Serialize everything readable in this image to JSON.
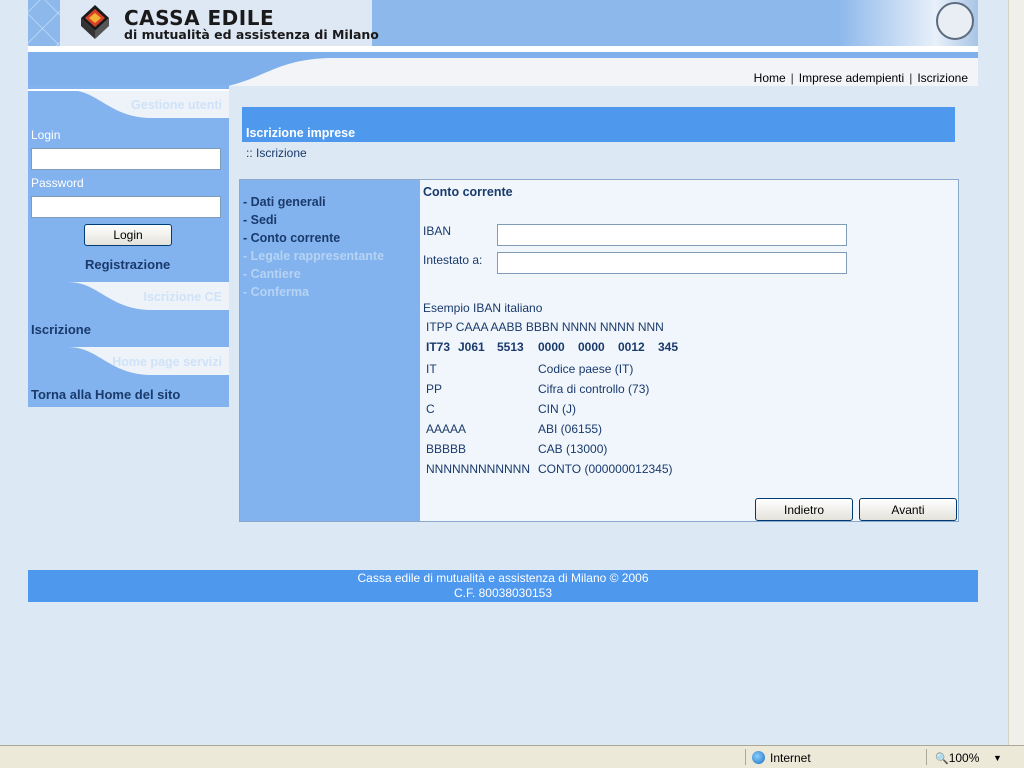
{
  "header": {
    "logo_title": "CASSA EDILE",
    "logo_subtitle": "di mutualità ed assistenza di Milano"
  },
  "topnav": {
    "items": [
      "Home",
      "Imprese adempienti",
      "Iscrizione"
    ]
  },
  "sidebar": {
    "section_users": "Gestione utenti",
    "login_label": "Login",
    "password_label": "Password",
    "login_value": "",
    "password_value": "",
    "login_button": "Login",
    "register_link": "Registrazione",
    "section_ce": "Iscrizione CE",
    "ce_link": "Iscrizione",
    "section_home": "Home page servizi",
    "home_link": "Torna alla Home del sito"
  },
  "main": {
    "title": "Iscrizione imprese",
    "breadcrumb": ":: Iscrizione",
    "steps": [
      {
        "label": "- Dati generali",
        "enabled": true
      },
      {
        "label": "- Sedi",
        "enabled": true
      },
      {
        "label": "- Conto corrente",
        "enabled": true
      },
      {
        "label": "- Legale rappresentante",
        "enabled": false
      },
      {
        "label": "- Cantiere",
        "enabled": false
      },
      {
        "label": "- Conferma",
        "enabled": false
      }
    ],
    "section_title": "Conto corrente",
    "iban_label": "IBAN",
    "iban_value": "",
    "holder_label": "Intestato a:",
    "holder_value": "",
    "example_title": "Esempio IBAN italiano",
    "example_format": "ITPP CAAA AABB BBBN NNNN NNNN NNN",
    "example_groups": [
      "IT73",
      "J061",
      "5513",
      "0000",
      "0000",
      "0012",
      "345"
    ],
    "legend": [
      {
        "code": "IT",
        "desc": "Codice paese (IT)"
      },
      {
        "code": "PP",
        "desc": "Cifra di controllo (73)"
      },
      {
        "code": "C",
        "desc": "CIN (J)"
      },
      {
        "code": "AAAAA",
        "desc": "ABI (06155)"
      },
      {
        "code": "BBBBB",
        "desc": "CAB (13000)"
      },
      {
        "code": "NNNNNNNNNNNN",
        "desc": "CONTO (000000012345)"
      }
    ],
    "back_button": "Indietro",
    "next_button": "Avanti"
  },
  "footer": {
    "line1": "Cassa edile di mutualità e assistenza di Milano © 2006",
    "line2": "C.F. 80038030153"
  },
  "statusbar": {
    "zone": "Internet",
    "zoom": "100%"
  }
}
